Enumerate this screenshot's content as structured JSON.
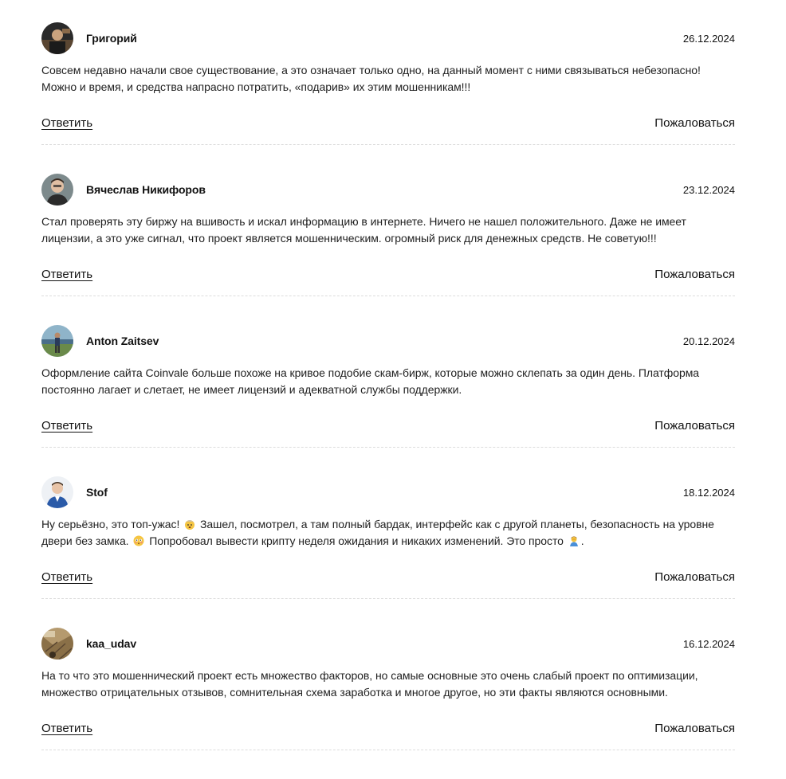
{
  "comments": [
    {
      "author": "Григорий",
      "date": "26.12.2024",
      "text_parts": [
        "Совсем недавно начали свое существование, а это означает только одно, на данный момент с ними связываться небезопасно! Можно и время, и средства напрасно потратить, «подарив» их этим мошенникам!!!"
      ],
      "reply_label": "Ответить",
      "report_label": "Пожаловаться"
    },
    {
      "author": "Вячеслав Никифоров",
      "date": "23.12.2024",
      "text_parts": [
        "Стал проверять эту биржу на вшивость и искал информацию в интернете. Ничего не нашел положительного. Даже не имеет лицензии, а это уже сигнал, что проект является мошенническим. огромный риск для денежных средств. Не советую!!!"
      ],
      "reply_label": "Ответить",
      "report_label": "Пожаловаться"
    },
    {
      "author": "Anton Zaitsev",
      "date": "20.12.2024",
      "text_parts": [
        "Оформление сайта Coinvale больше похоже на кривое подобие скам-бирж, которые можно склепать за один день. Платформа постоянно лагает и слетает, не имеет лицензий и адекватной службы поддержки."
      ],
      "reply_label": "Ответить",
      "report_label": "Пожаловаться"
    },
    {
      "author": "Stof",
      "date": "18.12.2024",
      "text_parts": [
        "Ну серьёзно, это топ-ужас! ",
        " Зашел, посмотрел, а там полный бардак, интерфейс как с другой планеты, безопасность на уровне двери без замка. ",
        " Попробовал вывести крипту неделя ожидания и никаких изменений. Это просто ",
        "."
      ],
      "emojis": [
        "exploding-head-emoji",
        "flushed-face-emoji",
        "person-facepalming-emoji"
      ],
      "reply_label": "Ответить",
      "report_label": "Пожаловаться"
    },
    {
      "author": "kaa_udav",
      "date": "16.12.2024",
      "text_parts": [
        "На то что это мошеннический проект есть множество факторов, но самые основные это очень слабый проект по оптимизации, множество отрицательных отзывов, сомнительная схема заработка и многое другое, но эти факты являются основными."
      ],
      "reply_label": "Ответить",
      "report_label": "Пожаловаться"
    }
  ],
  "colors": {
    "text": "#1a1a1a",
    "divider": "#dcdcdc",
    "background": "#ffffff"
  }
}
